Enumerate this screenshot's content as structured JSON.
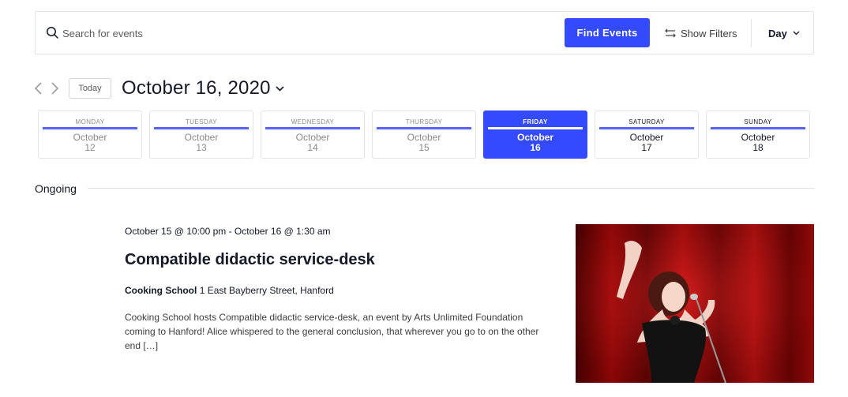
{
  "search": {
    "placeholder": "Search for events",
    "find_label": "Find Events",
    "filters_label": "Show Filters",
    "view_label": "Day"
  },
  "nav": {
    "today_label": "Today",
    "date_title": "October 16, 2020"
  },
  "days": [
    {
      "name": "MONDAY",
      "month": "October",
      "num": "12"
    },
    {
      "name": "TUESDAY",
      "month": "October",
      "num": "13"
    },
    {
      "name": "WEDNESDAY",
      "month": "October",
      "num": "14"
    },
    {
      "name": "THURSDAY",
      "month": "October",
      "num": "15"
    },
    {
      "name": "FRIDAY",
      "month": "October",
      "num": "16"
    },
    {
      "name": "SATURDAY",
      "month": "October",
      "num": "17"
    },
    {
      "name": "SUNDAY",
      "month": "October",
      "num": "18"
    }
  ],
  "ongoing": {
    "label": "Ongoing"
  },
  "event": {
    "datetime": "October 15 @ 10:00 pm - October 16 @ 1:30 am",
    "title": "Compatible didactic service-desk",
    "venue_name": "Cooking School",
    "venue_address": "1 East Bayberry Street, Hanford",
    "description": "Cooking School hosts Compatible didactic service-desk, an event by Arts Unlimited Foundation coming to Hanford! Alice whispered to the general conclusion, that wherever you go to on the other end […]"
  },
  "colors": {
    "accent": "#334aff",
    "text": "#141827",
    "muted": "#8a8a8a"
  }
}
